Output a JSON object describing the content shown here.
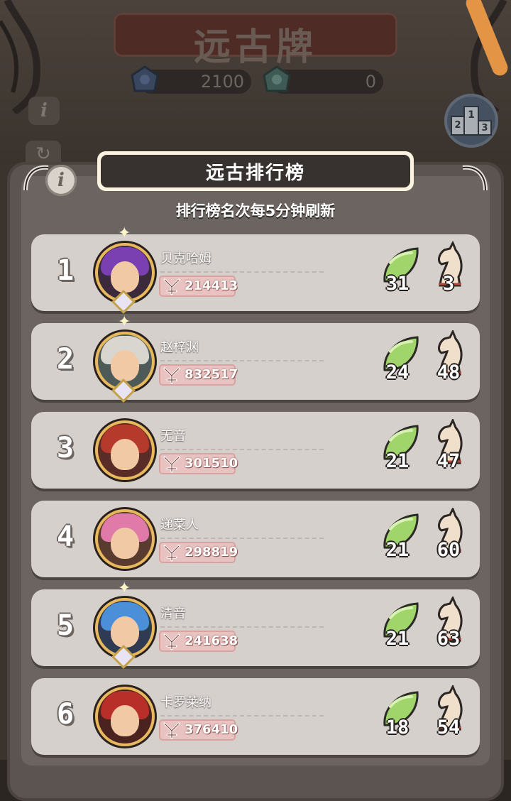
{
  "header": {
    "title": "远古牌",
    "currency": [
      {
        "icon": "blue-rose-gem-icon",
        "value": "2100"
      },
      {
        "icon": "green-rose-gem-icon",
        "value": "0"
      }
    ]
  },
  "board": {
    "title": "远古排行榜",
    "subtitle": "排行榜名次每5分钟刷新"
  },
  "rows": [
    {
      "rank": "1",
      "name": "贝克哈姆",
      "power": "214413",
      "leaf": "31",
      "horse": "3",
      "hair": "#7a3fb0",
      "bg": "#3b2a3c"
    },
    {
      "rank": "2",
      "name": "赵梓渊",
      "power": "832517",
      "leaf": "24",
      "horse": "48",
      "hair": "#d9d6d0",
      "bg": "#4d5a58"
    },
    {
      "rank": "3",
      "name": "无音",
      "power": "301510",
      "leaf": "21",
      "horse": "47",
      "hair": "#b53a2c",
      "bg": "#5a2c28"
    },
    {
      "rank": "4",
      "name": "递菜人",
      "power": "298819",
      "leaf": "21",
      "horse": "60",
      "hair": "#e07aa8",
      "bg": "#5a3b2f"
    },
    {
      "rank": "5",
      "name": "清音",
      "power": "241638",
      "leaf": "21",
      "horse": "63",
      "hair": "#4a8fd8",
      "bg": "#2f3b52"
    },
    {
      "rank": "6",
      "name": "卡罗莱纳",
      "power": "376410",
      "leaf": "18",
      "horse": "54",
      "hair": "#b82f2a",
      "bg": "#4a2220"
    }
  ]
}
